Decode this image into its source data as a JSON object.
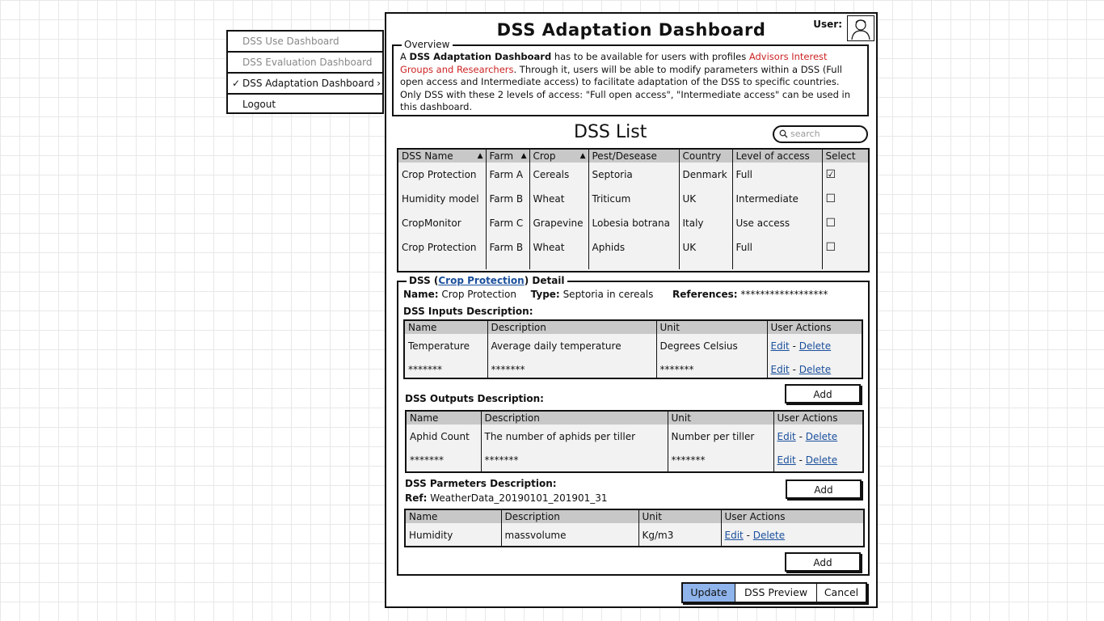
{
  "menu": {
    "items": [
      {
        "label": "DSS Use Dashboard",
        "state": "disabled"
      },
      {
        "label": "DSS Evaluation Dashboard",
        "state": "disabled"
      },
      {
        "label": "DSS Adaptation Dashboard",
        "state": "selected",
        "check": "✓",
        "chevron": "›"
      },
      {
        "label": "Logout",
        "state": "normal"
      }
    ]
  },
  "header": {
    "title": "DSS Adaptation Dashboard",
    "user_label": "User:"
  },
  "overview": {
    "legend": "Overview",
    "text_1": "A ",
    "bold_1": "DSS Adaptation Dashboard",
    "text_2": " has to be available for users with profiles ",
    "red_1": "Advisors Interest Groups and Researchers",
    "text_3": ". Through it, users will be able to modify parameters within a DSS (Full open access and Intermediate access) to facilitate adaptation of the DSS to specific countries. Only DSS with these 2 levels of access: \"Full open access\", \"Intermediate access\" can be used in this dashboard."
  },
  "dss_list": {
    "title": "DSS List",
    "search_placeholder": "search",
    "columns": [
      "DSS Name",
      "Farm",
      "Crop",
      "Pest/Desease",
      "Country",
      "Level of access",
      "Select"
    ],
    "rows": [
      [
        "Crop Protection",
        "Farm A",
        "Cereals",
        "Septoria",
        "Denmark",
        "Full",
        "☑"
      ],
      [
        "Humidity model",
        "Farm B",
        "Wheat",
        "Triticum",
        "UK",
        "Intermediate",
        "☐"
      ],
      [
        "CropMonitor",
        "Farm C",
        "Grapevine",
        "Lobesia botrana",
        "Italy",
        "Use access",
        "☐"
      ],
      [
        "Crop Protection",
        "Farm B",
        "Wheat",
        "Aphids",
        "UK",
        "Full",
        "☐"
      ]
    ]
  },
  "detail": {
    "legend_prefix": "DSS (",
    "legend_link": "Crop Protection",
    "legend_suffix": ") Detail",
    "name_label": "Name:",
    "name_value": "Crop Protection",
    "type_label": "Type:",
    "type_value": "Septoria in cereals",
    "refs_label": "References:",
    "refs_value": "******************",
    "inputs_title": "DSS Inputs Description:",
    "outputs_title": "DSS Outputs Description:",
    "params_title": "DSS Parmeters Description:",
    "params_ref_label": "Ref:",
    "params_ref_value": "WeatherData_20190101_201901_31",
    "columns": [
      "Name",
      "Description",
      "Unit",
      "User Actions"
    ],
    "edit": "Edit",
    "sep": " - ",
    "delete": "Delete",
    "add": "Add",
    "inputs": [
      [
        "Temperature",
        "Average daily temperature",
        "Degrees Celsius"
      ],
      [
        "*******",
        "*******",
        "*******"
      ]
    ],
    "outputs": [
      [
        "Aphid Count",
        "The number of aphids per tiller",
        "Number per tiller"
      ],
      [
        "*******",
        "*******",
        "*******"
      ]
    ],
    "params": [
      [
        "Humidity",
        "massvolume",
        "Kg/m3"
      ]
    ]
  },
  "footer": {
    "update": "Update",
    "preview": "DSS Preview",
    "cancel": "Cancel"
  }
}
